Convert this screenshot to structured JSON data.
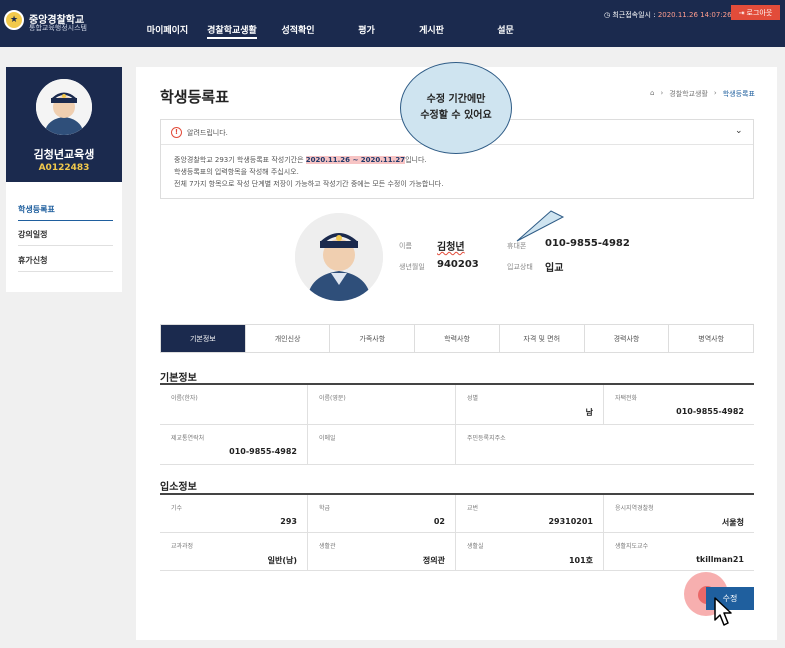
{
  "header": {
    "brand_title": "중앙경찰학교",
    "brand_sub": "통합교육행정시스템",
    "nav": [
      "마이페이지",
      "경찰학교생활",
      "성적확인",
      "평가",
      "게시판",
      "설문"
    ],
    "nav_active": 1,
    "last_login_label": "최근접속일시 :",
    "last_login_time": "2020.11.26 14:07:26",
    "logout_label": "로그아웃"
  },
  "profile": {
    "name": "김청년교육생",
    "id": "A0122483"
  },
  "sidebar": {
    "items": [
      {
        "label": "학생등록표"
      },
      {
        "label": "강의일정"
      },
      {
        "label": "휴가신청"
      }
    ]
  },
  "main": {
    "title": "학생등록표",
    "breadcrumb": [
      "경찰학교생활",
      "학생등록표"
    ],
    "notice": {
      "label": "알려드립니다.",
      "line1_pre": "중앙경찰학교 293기 학생등록표 작성기간은 ",
      "line1_period": "2020.11.26 ~ 2020.11.27",
      "line1_post": "입니다.",
      "line2": "학생등록표의 입력항목을 작성해 주십시오.",
      "line3": "전체 7가지 항목으로 작성 단계별 저장이 가능하고 작성기간 중에는 모든 수정이 가능합니다."
    },
    "tooltip": {
      "line1": "수정 기간에만",
      "line2": "수정할 수 있어요"
    },
    "student": {
      "name_label": "이름",
      "name": "김청년",
      "phone_label": "휴대폰",
      "phone": "010-9855-4982",
      "birth_label": "생년월일",
      "birth": "940203",
      "status_label": "입교상태",
      "status": "입교"
    },
    "tabs": [
      "기본정보",
      "개인신상",
      "가족사항",
      "학력사항",
      "자격 및 면허",
      "경력사항",
      "병역사항"
    ],
    "tab_active": 0,
    "basic": {
      "title": "기본정보",
      "cells": [
        {
          "label": "이름(한자)",
          "value": ""
        },
        {
          "label": "이름(영문)",
          "value": ""
        },
        {
          "label": "성별",
          "value": "남"
        },
        {
          "label": "자택전화",
          "value": "010-9855-4982"
        },
        {
          "label": "제교통연락처",
          "value": "010-9855-4982"
        },
        {
          "label": "이메일",
          "value": ""
        },
        {
          "label": "주민등록지주소",
          "value": ""
        }
      ]
    },
    "admission": {
      "title": "입소정보",
      "cells": [
        {
          "label": "기수",
          "value": "293"
        },
        {
          "label": "학급",
          "value": "02"
        },
        {
          "label": "교번",
          "value": "29310201"
        },
        {
          "label": "응시지역경찰청",
          "value": "서울청"
        },
        {
          "label": "교과과정",
          "value": "일반(남)"
        },
        {
          "label": "생활관",
          "value": "정의관"
        },
        {
          "label": "생활실",
          "value": "101호"
        },
        {
          "label": "생활지도교수",
          "value": "tkillman21"
        }
      ]
    },
    "edit_button": "수정"
  }
}
